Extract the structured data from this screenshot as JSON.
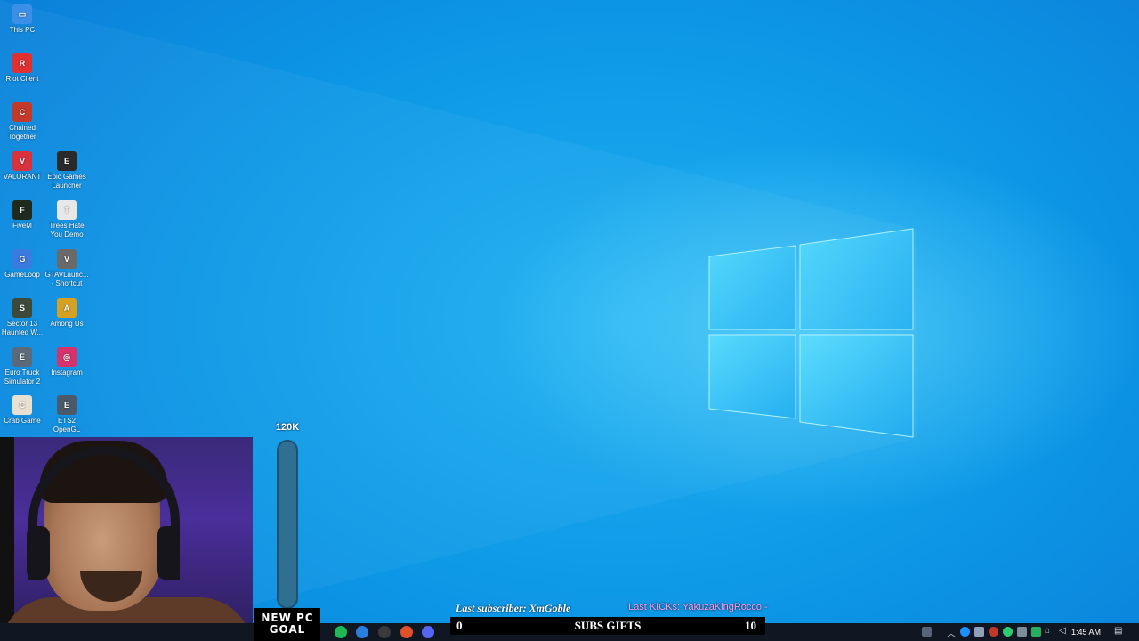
{
  "desktop": {
    "icons": [
      {
        "label": "This PC",
        "color": "#3b8fe6",
        "glyph": "▭"
      },
      {
        "label": "Riot Client",
        "color": "#e03030",
        "glyph": "R"
      },
      {
        "label": "Chained Together",
        "color": "#c43a2a",
        "glyph": "C"
      },
      {
        "label": "VALORANT",
        "color": "#d9323f",
        "glyph": "V"
      },
      {
        "label": "Epic Games Launcher",
        "color": "#2a2a2a",
        "glyph": "E"
      },
      {
        "label": "FiveM",
        "color": "#1f2a1f",
        "glyph": "F"
      },
      {
        "label": "Trees Hate You Demo",
        "color": "#e8e8e8",
        "glyph": "T"
      },
      {
        "label": "GameLoop",
        "color": "#3a7be0",
        "glyph": "G"
      },
      {
        "label": "GTAVLaunc... - Shortcut",
        "color": "#6a6a6a",
        "glyph": "V"
      },
      {
        "label": "Sector 13 Haunted W...",
        "color": "#3d4a3a",
        "glyph": "S"
      },
      {
        "label": "Among Us",
        "color": "#d8a020",
        "glyph": "A"
      },
      {
        "label": "Euro Truck Simulator 2",
        "color": "#5a6a7a",
        "glyph": "E"
      },
      {
        "label": "Instagram",
        "color": "#d6336c",
        "glyph": "◎"
      },
      {
        "label": "Crab Game",
        "color": "#e8e0d0",
        "glyph": "C"
      },
      {
        "label": "ETS2 OpenGL",
        "color": "#4a5a6a",
        "glyph": "E"
      }
    ]
  },
  "overlay": {
    "goal_amount": "120K",
    "goal_progress": 0,
    "goal_label_line1": "NEW PC",
    "goal_label_line2": "GOAL",
    "last_subscriber": "Last subscriber: XmGoble",
    "last_kicks": "Last KICKs: YakuzaKingRocco -",
    "subs_gifts_title": "SUBS GIFTS",
    "subs_gifts_current": "0",
    "subs_gifts_target": "10"
  },
  "taskbar": {
    "apps": [
      {
        "name": "spotify-icon",
        "color": "#1db954"
      },
      {
        "name": "store-icon",
        "color": "#2b7de0"
      },
      {
        "name": "obs-icon",
        "color": "#3a3a3a"
      },
      {
        "name": "brave-icon",
        "color": "#e0502a"
      },
      {
        "name": "discord-icon",
        "color": "#5865f2"
      }
    ],
    "clock": "1:45 AM"
  }
}
